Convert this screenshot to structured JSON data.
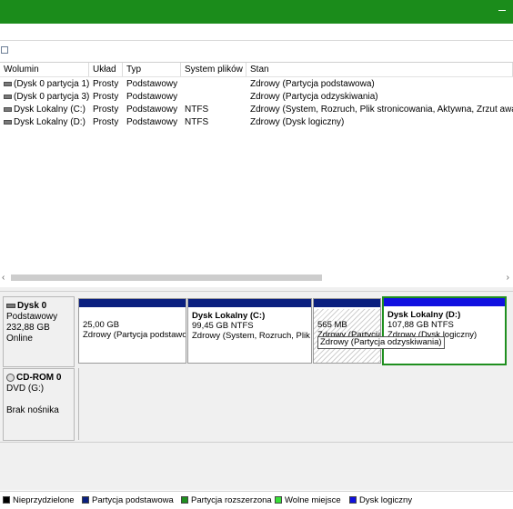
{
  "volumes": {
    "headers": [
      "Wolumin",
      "Układ",
      "Typ",
      "System plików",
      "Stan"
    ],
    "rows": [
      {
        "name": "(Dysk 0 partycja 1)",
        "layout": "Prosty",
        "type": "Podstawowy",
        "fs": "",
        "status": "Zdrowy (Partycja podstawowa)"
      },
      {
        "name": "(Dysk 0 partycja 3)",
        "layout": "Prosty",
        "type": "Podstawowy",
        "fs": "",
        "status": "Zdrowy (Partycja odzyskiwania)"
      },
      {
        "name": "Dysk Lokalny (C:)",
        "layout": "Prosty",
        "type": "Podstawowy",
        "fs": "NTFS",
        "status": "Zdrowy (System, Rozruch, Plik stronicowania, Aktywna, Zrzut awa"
      },
      {
        "name": "Dysk Lokalny (D:)",
        "layout": "Prosty",
        "type": "Podstawowy",
        "fs": "NTFS",
        "status": "Zdrowy (Dysk logiczny)"
      }
    ]
  },
  "disks": [
    {
      "name": "Dysk 0",
      "type": "Podstawowy",
      "size": "232,88 GB",
      "state": "Online",
      "partitions": [
        {
          "name": "",
          "size": "25,00 GB",
          "status": "Zdrowy (Partycja podstawowa)"
        },
        {
          "name": "Dysk Lokalny  (C:)",
          "size": "99,45 GB NTFS",
          "status": "Zdrowy (System, Rozruch, Plik stronicowania"
        },
        {
          "name": "",
          "size": "565 MB",
          "status": "Zdrowy (Partycja odzyskiwania)"
        },
        {
          "name": "Dysk Lokalny  (D:)",
          "size": "107,88 GB NTFS",
          "status": "Zdrowy (Dysk logiczny)"
        }
      ]
    },
    {
      "name": "CD-ROM 0",
      "type": "DVD (G:)",
      "media": "Brak nośnika"
    }
  ],
  "tooltip": "Zdrowy (Partycja odzyskiwania)",
  "legend": [
    {
      "label": "Nieprzydzielone",
      "color": "#000000"
    },
    {
      "label": "Partycja podstawowa",
      "color": "#0a1f7f"
    },
    {
      "label": "Partycja rozszerzona",
      "color": "#1f8f1f"
    },
    {
      "label": "Wolne miejsce",
      "color": "#38e038"
    },
    {
      "label": "Dysk logiczny",
      "color": "#1010e0"
    }
  ],
  "colors": {
    "titlebar": "#1b8c1b",
    "primary_partition": "#0a1f7f",
    "logical_drive": "#1010e0",
    "selection": "#1f8f1f"
  }
}
